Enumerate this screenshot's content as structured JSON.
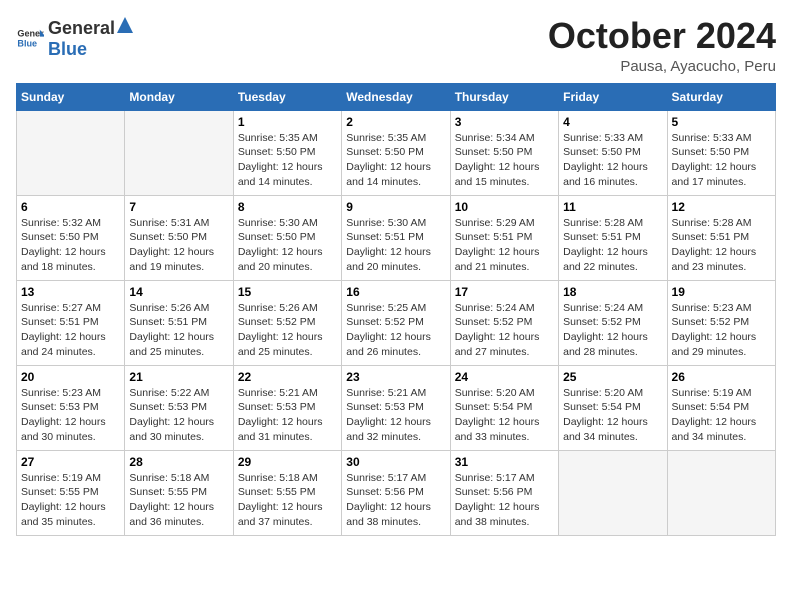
{
  "logo": {
    "general": "General",
    "blue": "Blue"
  },
  "title": {
    "month_year": "October 2024",
    "location": "Pausa, Ayacucho, Peru"
  },
  "weekdays": [
    "Sunday",
    "Monday",
    "Tuesday",
    "Wednesday",
    "Thursday",
    "Friday",
    "Saturday"
  ],
  "weeks": [
    [
      {
        "day": "",
        "info": ""
      },
      {
        "day": "",
        "info": ""
      },
      {
        "day": "1",
        "info": "Sunrise: 5:35 AM\nSunset: 5:50 PM\nDaylight: 12 hours\nand 14 minutes."
      },
      {
        "day": "2",
        "info": "Sunrise: 5:35 AM\nSunset: 5:50 PM\nDaylight: 12 hours\nand 14 minutes."
      },
      {
        "day": "3",
        "info": "Sunrise: 5:34 AM\nSunset: 5:50 PM\nDaylight: 12 hours\nand 15 minutes."
      },
      {
        "day": "4",
        "info": "Sunrise: 5:33 AM\nSunset: 5:50 PM\nDaylight: 12 hours\nand 16 minutes."
      },
      {
        "day": "5",
        "info": "Sunrise: 5:33 AM\nSunset: 5:50 PM\nDaylight: 12 hours\nand 17 minutes."
      }
    ],
    [
      {
        "day": "6",
        "info": "Sunrise: 5:32 AM\nSunset: 5:50 PM\nDaylight: 12 hours\nand 18 minutes."
      },
      {
        "day": "7",
        "info": "Sunrise: 5:31 AM\nSunset: 5:50 PM\nDaylight: 12 hours\nand 19 minutes."
      },
      {
        "day": "8",
        "info": "Sunrise: 5:30 AM\nSunset: 5:50 PM\nDaylight: 12 hours\nand 20 minutes."
      },
      {
        "day": "9",
        "info": "Sunrise: 5:30 AM\nSunset: 5:51 PM\nDaylight: 12 hours\nand 20 minutes."
      },
      {
        "day": "10",
        "info": "Sunrise: 5:29 AM\nSunset: 5:51 PM\nDaylight: 12 hours\nand 21 minutes."
      },
      {
        "day": "11",
        "info": "Sunrise: 5:28 AM\nSunset: 5:51 PM\nDaylight: 12 hours\nand 22 minutes."
      },
      {
        "day": "12",
        "info": "Sunrise: 5:28 AM\nSunset: 5:51 PM\nDaylight: 12 hours\nand 23 minutes."
      }
    ],
    [
      {
        "day": "13",
        "info": "Sunrise: 5:27 AM\nSunset: 5:51 PM\nDaylight: 12 hours\nand 24 minutes."
      },
      {
        "day": "14",
        "info": "Sunrise: 5:26 AM\nSunset: 5:51 PM\nDaylight: 12 hours\nand 25 minutes."
      },
      {
        "day": "15",
        "info": "Sunrise: 5:26 AM\nSunset: 5:52 PM\nDaylight: 12 hours\nand 25 minutes."
      },
      {
        "day": "16",
        "info": "Sunrise: 5:25 AM\nSunset: 5:52 PM\nDaylight: 12 hours\nand 26 minutes."
      },
      {
        "day": "17",
        "info": "Sunrise: 5:24 AM\nSunset: 5:52 PM\nDaylight: 12 hours\nand 27 minutes."
      },
      {
        "day": "18",
        "info": "Sunrise: 5:24 AM\nSunset: 5:52 PM\nDaylight: 12 hours\nand 28 minutes."
      },
      {
        "day": "19",
        "info": "Sunrise: 5:23 AM\nSunset: 5:52 PM\nDaylight: 12 hours\nand 29 minutes."
      }
    ],
    [
      {
        "day": "20",
        "info": "Sunrise: 5:23 AM\nSunset: 5:53 PM\nDaylight: 12 hours\nand 30 minutes."
      },
      {
        "day": "21",
        "info": "Sunrise: 5:22 AM\nSunset: 5:53 PM\nDaylight: 12 hours\nand 30 minutes."
      },
      {
        "day": "22",
        "info": "Sunrise: 5:21 AM\nSunset: 5:53 PM\nDaylight: 12 hours\nand 31 minutes."
      },
      {
        "day": "23",
        "info": "Sunrise: 5:21 AM\nSunset: 5:53 PM\nDaylight: 12 hours\nand 32 minutes."
      },
      {
        "day": "24",
        "info": "Sunrise: 5:20 AM\nSunset: 5:54 PM\nDaylight: 12 hours\nand 33 minutes."
      },
      {
        "day": "25",
        "info": "Sunrise: 5:20 AM\nSunset: 5:54 PM\nDaylight: 12 hours\nand 34 minutes."
      },
      {
        "day": "26",
        "info": "Sunrise: 5:19 AM\nSunset: 5:54 PM\nDaylight: 12 hours\nand 34 minutes."
      }
    ],
    [
      {
        "day": "27",
        "info": "Sunrise: 5:19 AM\nSunset: 5:55 PM\nDaylight: 12 hours\nand 35 minutes."
      },
      {
        "day": "28",
        "info": "Sunrise: 5:18 AM\nSunset: 5:55 PM\nDaylight: 12 hours\nand 36 minutes."
      },
      {
        "day": "29",
        "info": "Sunrise: 5:18 AM\nSunset: 5:55 PM\nDaylight: 12 hours\nand 37 minutes."
      },
      {
        "day": "30",
        "info": "Sunrise: 5:17 AM\nSunset: 5:56 PM\nDaylight: 12 hours\nand 38 minutes."
      },
      {
        "day": "31",
        "info": "Sunrise: 5:17 AM\nSunset: 5:56 PM\nDaylight: 12 hours\nand 38 minutes."
      },
      {
        "day": "",
        "info": ""
      },
      {
        "day": "",
        "info": ""
      }
    ]
  ]
}
